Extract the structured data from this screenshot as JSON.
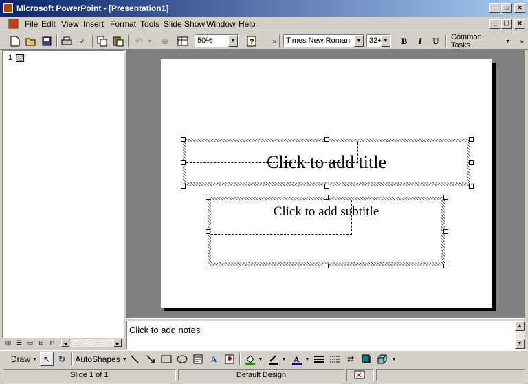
{
  "window": {
    "title": "Microsoft PowerPoint - [Presentation1]"
  },
  "menu": {
    "items": [
      "File",
      "Edit",
      "View",
      "Insert",
      "Format",
      "Tools",
      "Slide Show",
      "Window",
      "Help"
    ]
  },
  "toolbar": {
    "zoom": "50%",
    "font": "Times New Roman",
    "font_size": "32+",
    "bold": "B",
    "italic": "I",
    "underline": "U",
    "common_tasks": "Common Tasks"
  },
  "outline": {
    "slide_number": "1"
  },
  "slide": {
    "title_placeholder": "Click to add title",
    "subtitle_placeholder": "Click to add subtitle"
  },
  "notes": {
    "placeholder": "Click to add notes"
  },
  "drawing": {
    "draw_label": "Draw",
    "autoshapes_label": "AutoShapes"
  },
  "status": {
    "slide": "Slide 1 of 1",
    "design": "Default Design"
  },
  "colors": {
    "titlebar_start": "#0a246a",
    "titlebar_end": "#a6caf0",
    "face": "#d4d0c8",
    "workspace": "#808080"
  }
}
